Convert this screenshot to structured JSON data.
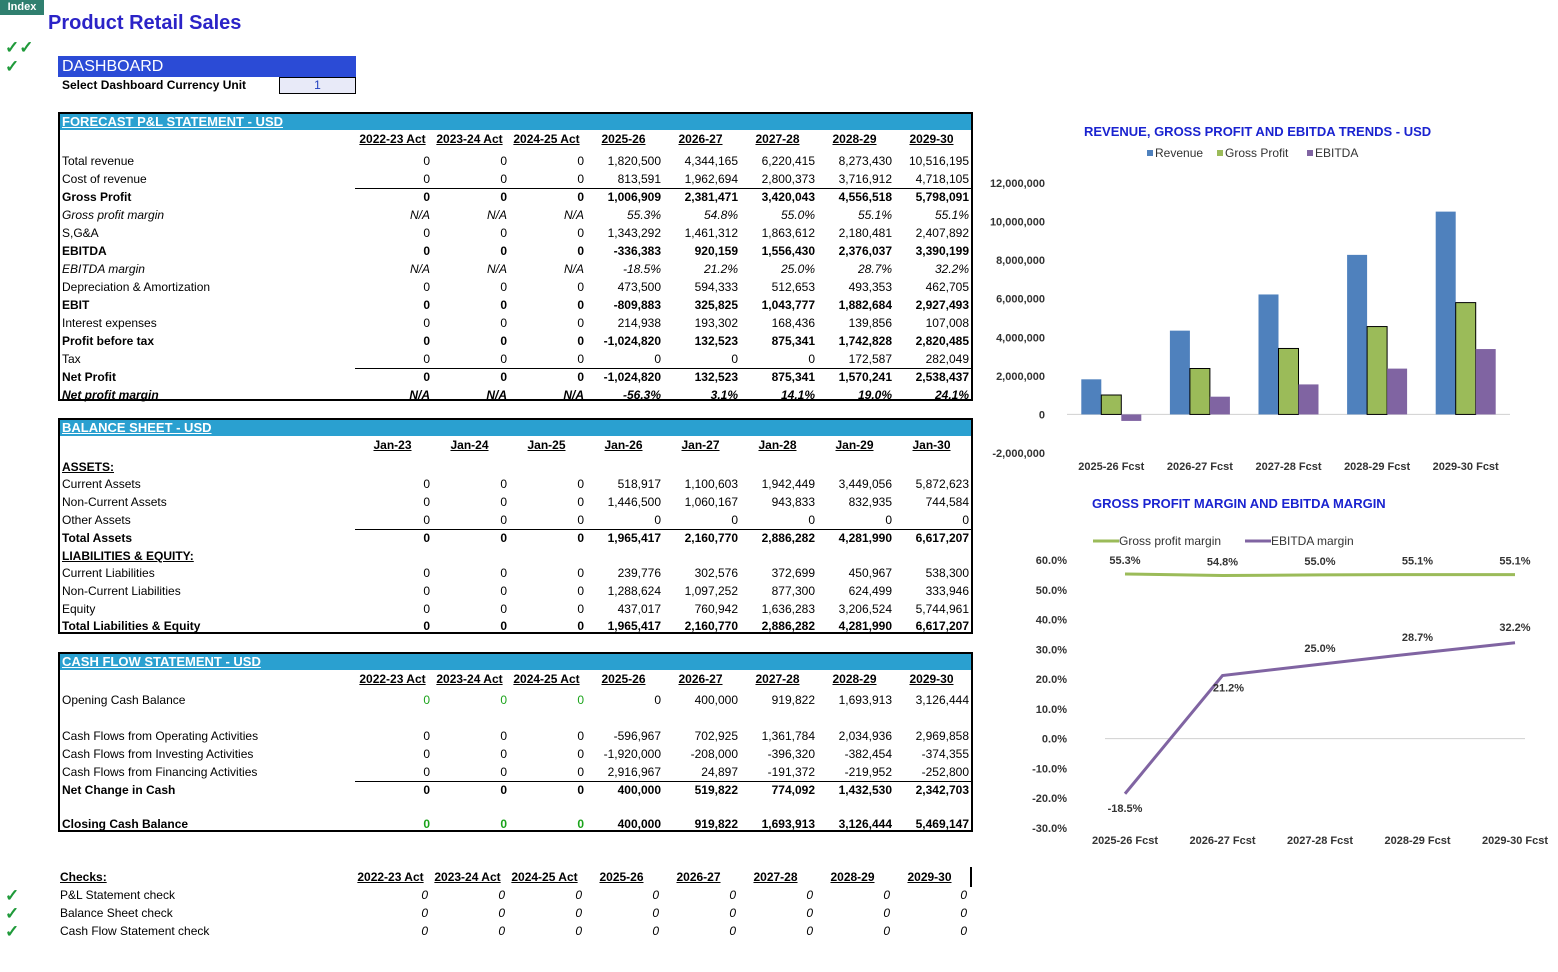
{
  "index_label": "Index",
  "title": "Product Retail Sales",
  "dashboard": {
    "header": "DASHBOARD",
    "select_label": "Select Dashboard Currency Unit",
    "select_value": "1"
  },
  "pl": {
    "header": "FORECAST P&L STATEMENT - USD",
    "columns": [
      "2022-23 Act",
      "2023-24 Act",
      "2024-25 Act",
      "2025-26",
      "2026-27",
      "2027-28",
      "2028-29",
      "2029-30"
    ],
    "rows": [
      {
        "label": "Total revenue",
        "style": "",
        "values": [
          "0",
          "0",
          "0",
          "1,820,500",
          "4,344,165",
          "6,220,415",
          "8,273,430",
          "10,516,195"
        ]
      },
      {
        "label": "Cost of revenue",
        "style": "",
        "values": [
          "0",
          "0",
          "0",
          "813,591",
          "1,962,694",
          "2,800,373",
          "3,716,912",
          "4,718,105"
        ]
      },
      {
        "label": "Gross Profit",
        "style": "b",
        "values": [
          "0",
          "0",
          "0",
          "1,006,909",
          "2,381,471",
          "3,420,043",
          "4,556,518",
          "5,798,091"
        ]
      },
      {
        "label": "Gross profit margin",
        "style": "i",
        "values": [
          "N/A",
          "N/A",
          "N/A",
          "55.3%",
          "54.8%",
          "55.0%",
          "55.1%",
          "55.1%"
        ]
      },
      {
        "label": "S,G&A",
        "style": "",
        "values": [
          "0",
          "0",
          "0",
          "1,343,292",
          "1,461,312",
          "1,863,612",
          "2,180,481",
          "2,407,892"
        ]
      },
      {
        "label": "EBITDA",
        "style": "b",
        "values": [
          "0",
          "0",
          "0",
          "-336,383",
          "920,159",
          "1,556,430",
          "2,376,037",
          "3,390,199"
        ]
      },
      {
        "label": "EBITDA margin",
        "style": "i",
        "values": [
          "N/A",
          "N/A",
          "N/A",
          "-18.5%",
          "21.2%",
          "25.0%",
          "28.7%",
          "32.2%"
        ]
      },
      {
        "label": "Depreciation & Amortization",
        "style": "",
        "values": [
          "0",
          "0",
          "0",
          "473,500",
          "594,333",
          "512,653",
          "493,353",
          "462,705"
        ]
      },
      {
        "label": "EBIT",
        "style": "b",
        "values": [
          "0",
          "0",
          "0",
          "-809,883",
          "325,825",
          "1,043,777",
          "1,882,684",
          "2,927,493"
        ]
      },
      {
        "label": "Interest expenses",
        "style": "",
        "values": [
          "0",
          "0",
          "0",
          "214,938",
          "193,302",
          "168,436",
          "139,856",
          "107,008"
        ]
      },
      {
        "label": "Profit before tax",
        "style": "b",
        "values": [
          "0",
          "0",
          "0",
          "-1,024,820",
          "132,523",
          "875,341",
          "1,742,828",
          "2,820,485"
        ]
      },
      {
        "label": "Tax",
        "style": "",
        "values": [
          "0",
          "0",
          "0",
          "0",
          "0",
          "0",
          "172,587",
          "282,049"
        ]
      },
      {
        "label": "Net Profit",
        "style": "b",
        "values": [
          "0",
          "0",
          "0",
          "-1,024,820",
          "132,523",
          "875,341",
          "1,570,241",
          "2,538,437"
        ]
      },
      {
        "label": "Net profit margin",
        "style": "bi",
        "values": [
          "N/A",
          "N/A",
          "N/A",
          "-56.3%",
          "3.1%",
          "14.1%",
          "19.0%",
          "24.1%"
        ]
      }
    ]
  },
  "bs": {
    "header": "BALANCE SHEET - USD",
    "columns": [
      "Jan-23",
      "Jan-24",
      "Jan-25",
      "Jan-26",
      "Jan-27",
      "Jan-28",
      "Jan-29",
      "Jan-30"
    ],
    "rows": [
      {
        "label": "ASSETS:",
        "style": "bu",
        "values": [
          "",
          "",
          "",
          "",
          "",
          "",
          "",
          ""
        ]
      },
      {
        "label": "Current Assets",
        "style": "",
        "values": [
          "0",
          "0",
          "0",
          "518,917",
          "1,100,603",
          "1,942,449",
          "3,449,056",
          "5,872,623"
        ]
      },
      {
        "label": "Non-Current Assets",
        "style": "",
        "values": [
          "0",
          "0",
          "0",
          "1,446,500",
          "1,060,167",
          "943,833",
          "832,935",
          "744,584"
        ]
      },
      {
        "label": "Other Assets",
        "style": "",
        "values": [
          "0",
          "0",
          "0",
          "0",
          "0",
          "0",
          "0",
          "0"
        ]
      },
      {
        "label": "Total Assets",
        "style": "b",
        "values": [
          "0",
          "0",
          "0",
          "1,965,417",
          "2,160,770",
          "2,886,282",
          "4,281,990",
          "6,617,207"
        ]
      },
      {
        "label": "LIABILITIES & EQUITY:",
        "style": "bu",
        "values": [
          "",
          "",
          "",
          "",
          "",
          "",
          "",
          ""
        ]
      },
      {
        "label": "Current Liabilities",
        "style": "",
        "values": [
          "0",
          "0",
          "0",
          "239,776",
          "302,576",
          "372,699",
          "450,967",
          "538,300"
        ]
      },
      {
        "label": "Non-Current Liabilities",
        "style": "",
        "values": [
          "0",
          "0",
          "0",
          "1,288,624",
          "1,097,252",
          "877,300",
          "624,499",
          "333,946"
        ]
      },
      {
        "label": "Equity",
        "style": "",
        "values": [
          "0",
          "0",
          "0",
          "437,017",
          "760,942",
          "1,636,283",
          "3,206,524",
          "5,744,961"
        ]
      },
      {
        "label": "Total Liabilities & Equity",
        "style": "b",
        "values": [
          "0",
          "0",
          "0",
          "1,965,417",
          "2,160,770",
          "2,886,282",
          "4,281,990",
          "6,617,207"
        ]
      }
    ]
  },
  "cf": {
    "header": "CASH FLOW STATEMENT -  USD",
    "columns": [
      "2022-23 Act",
      "2023-24 Act",
      "2024-25 Act",
      "2025-26",
      "2026-27",
      "2027-28",
      "2028-29",
      "2029-30"
    ],
    "rows": [
      {
        "label": "Opening Cash Balance",
        "style": "",
        "values": [
          "0",
          "0",
          "0",
          "0",
          "400,000",
          "919,822",
          "1,693,913",
          "3,126,444"
        ]
      },
      {
        "label": "Cash Flows from Operating Activities",
        "style": "",
        "values": [
          "0",
          "0",
          "0",
          "-596,967",
          "702,925",
          "1,361,784",
          "2,034,936",
          "2,969,858"
        ]
      },
      {
        "label": "Cash Flows from Investing Activities",
        "style": "",
        "values": [
          "0",
          "0",
          "0",
          "-1,920,000",
          "-208,000",
          "-396,320",
          "-382,454",
          "-374,355"
        ]
      },
      {
        "label": "Cash Flows from Financing Activities",
        "style": "",
        "values": [
          "0",
          "0",
          "0",
          "2,916,967",
          "24,897",
          "-191,372",
          "-219,952",
          "-252,800"
        ]
      },
      {
        "label": "Net Change in Cash",
        "style": "b",
        "values": [
          "0",
          "0",
          "0",
          "400,000",
          "519,822",
          "774,092",
          "1,432,530",
          "2,342,703"
        ]
      },
      {
        "label": "Closing Cash Balance",
        "style": "b",
        "values": [
          "0",
          "0",
          "0",
          "400,000",
          "919,822",
          "1,693,913",
          "3,126,444",
          "5,469,147"
        ]
      }
    ]
  },
  "checks": {
    "header": "Checks:",
    "columns": [
      "2022-23 Act",
      "2023-24 Act",
      "2024-25 Act",
      "2025-26",
      "2026-27",
      "2027-28",
      "2028-29",
      "2029-30"
    ],
    "rows": [
      {
        "label": "P&L Statement check",
        "values": [
          "0",
          "0",
          "0",
          "0",
          "0",
          "0",
          "0",
          "0"
        ]
      },
      {
        "label": "Balance Sheet check",
        "values": [
          "0",
          "0",
          "0",
          "0",
          "0",
          "0",
          "0",
          "0"
        ]
      },
      {
        "label": "Cash Flow Statement check",
        "values": [
          "0",
          "0",
          "0",
          "0",
          "0",
          "0",
          "0",
          "0"
        ]
      }
    ]
  },
  "colors": {
    "revenue": "#4f81bd",
    "gross_profit": "#9bbb59",
    "ebitda": "#8064a2",
    "section_header": "#2aa0d0",
    "dashboard": "#2b4bd6",
    "check": "#1f9a3a"
  },
  "chart_data": [
    {
      "type": "bar",
      "title": "REVENUE, GROSS PROFIT AND EBITDA TRENDS - USD",
      "categories": [
        "2025-26 Fcst",
        "2026-27 Fcst",
        "2027-28 Fcst",
        "2028-29 Fcst",
        "2029-30 Fcst"
      ],
      "series": [
        {
          "name": "Revenue",
          "values": [
            1820500,
            4344165,
            6220415,
            8273430,
            10516195
          ]
        },
        {
          "name": "Gross Profit",
          "values": [
            1006909,
            2381471,
            3420043,
            4556518,
            5798091
          ]
        },
        {
          "name": "EBITDA",
          "values": [
            -336383,
            920159,
            1556430,
            2376037,
            3390199
          ]
        }
      ],
      "y_ticks": [
        "12,000,000",
        "10,000,000",
        "8,000,000",
        "6,000,000",
        "4,000,000",
        "2,000,000",
        "0",
        "-2,000,000"
      ],
      "ylim": [
        -2000000,
        12000000
      ],
      "legend": "top"
    },
    {
      "type": "line",
      "title": "GROSS PROFIT MARGIN AND EBITDA MARGIN",
      "categories": [
        "2025-26 Fcst",
        "2026-27 Fcst",
        "2027-28 Fcst",
        "2028-29 Fcst",
        "2029-30 Fcst"
      ],
      "series": [
        {
          "name": "Gross profit margin",
          "values": [
            55.3,
            54.8,
            55.0,
            55.1,
            55.1
          ],
          "labels": [
            "55.3%",
            "54.8%",
            "55.0%",
            "55.1%",
            "55.1%"
          ]
        },
        {
          "name": "EBITDA margin",
          "values": [
            -18.5,
            21.2,
            25.0,
            28.7,
            32.2
          ],
          "labels": [
            "-18.5%",
            "21.2%",
            "25.0%",
            "28.7%",
            "32.2%"
          ]
        }
      ],
      "y_ticks": [
        "60.0%",
        "50.0%",
        "40.0%",
        "30.0%",
        "20.0%",
        "10.0%",
        "0.0%",
        "-10.0%",
        "-20.0%",
        "-30.0%"
      ],
      "ylim": [
        -30,
        60
      ],
      "legend": "top"
    }
  ]
}
